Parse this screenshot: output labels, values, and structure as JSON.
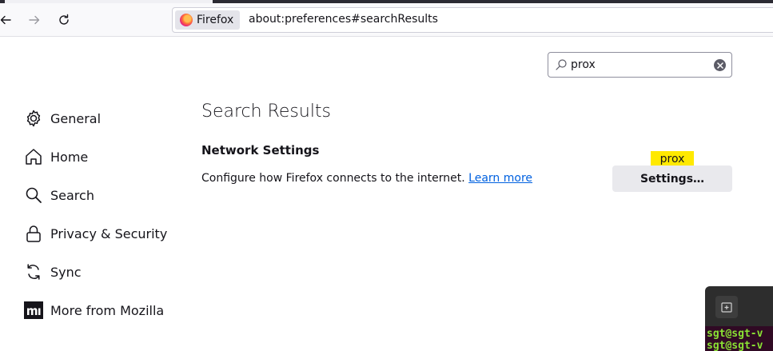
{
  "browser": {
    "identity_label": "Firefox",
    "url": "about:preferences#searchResults"
  },
  "search": {
    "value": "prox"
  },
  "sidebar": {
    "items": [
      {
        "label": "General",
        "icon": "gear-icon"
      },
      {
        "label": "Home",
        "icon": "home-icon"
      },
      {
        "label": "Search",
        "icon": "search-icon"
      },
      {
        "label": "Privacy & Security",
        "icon": "lock-icon"
      },
      {
        "label": "Sync",
        "icon": "sync-icon"
      },
      {
        "label": "More from Mozilla",
        "icon": "mozilla-icon"
      }
    ]
  },
  "main": {
    "title": "Search Results",
    "section_title": "Network Settings",
    "description": "Configure how Firefox connects to the internet.",
    "learn_more": "Learn more",
    "highlight": "prox",
    "settings_button": "Settings…"
  },
  "terminal": {
    "lines": [
      "sgt@sgt-v",
      "sgt@sgt-v"
    ]
  },
  "colors": {
    "accent": "#0061e0",
    "highlight": "#ffe900",
    "terminal_prompt": "#8ae234"
  }
}
